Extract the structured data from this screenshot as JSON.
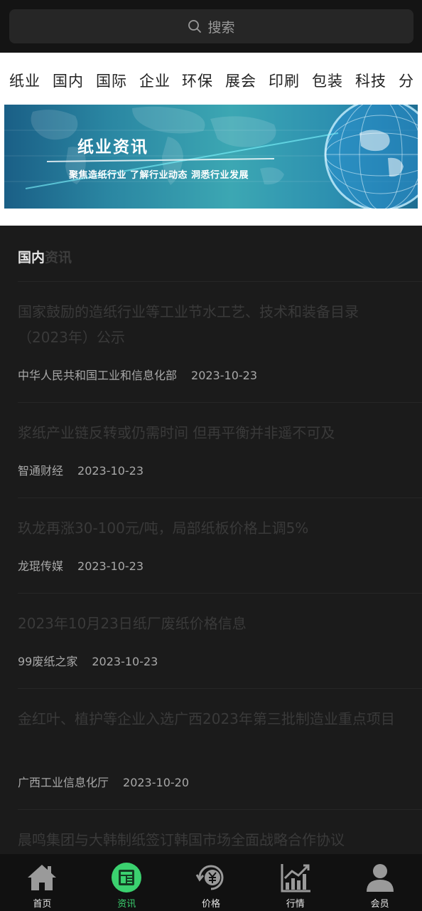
{
  "search": {
    "placeholder": "搜索"
  },
  "categories": [
    "纸业",
    "国内",
    "国际",
    "企业",
    "环保",
    "展会",
    "印刷",
    "包装",
    "科技",
    "分"
  ],
  "banner": {
    "title": "纸业资讯",
    "subtitle": "聚焦造纸行业  了解行业动态  洞悉行业发展"
  },
  "section": {
    "title_a": "国内",
    "title_b": "资讯"
  },
  "news": [
    {
      "title": "国家鼓励的造纸行业等工业节水工艺、技术和装备目录（2023年）公示",
      "source": "中华人民共和国工业和信息化部",
      "date": "2023-10-23"
    },
    {
      "title": "浆纸产业链反转或仍需时间 但再平衡并非遥不可及",
      "source": "智通财经",
      "date": "2023-10-23"
    },
    {
      "title": "玖龙再涨30-100元/吨，局部纸板价格上调5%",
      "source": "龙琨传媒",
      "date": "2023-10-23"
    },
    {
      "title": "2023年10月23日纸厂废纸价格信息",
      "source": "99废纸之家",
      "date": "2023-10-23"
    },
    {
      "title": "金红叶、植护等企业入选广西2023年第三批制造业重点项目",
      "source": "广西工业信息化厅",
      "date": "2023-10-20"
    },
    {
      "title": "晨鸣集团与大韩制纸签订韩国市场全面战略合作协议",
      "source": "",
      "date": ""
    }
  ],
  "tabbar": [
    {
      "label": "首页",
      "icon": "home-icon"
    },
    {
      "label": "资讯",
      "icon": "news-icon"
    },
    {
      "label": "价格",
      "icon": "price-icon"
    },
    {
      "label": "行情",
      "icon": "chart-icon"
    },
    {
      "label": "会员",
      "icon": "user-icon"
    }
  ],
  "colors": {
    "accent": "#3bd16f",
    "background": "#1b1b1b"
  }
}
